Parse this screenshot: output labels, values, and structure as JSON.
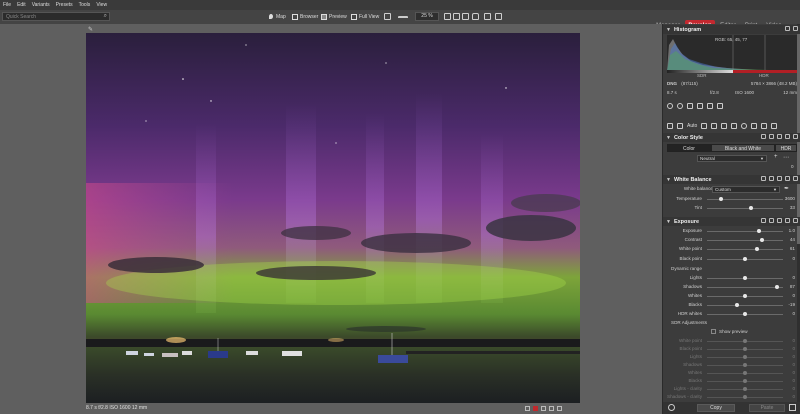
{
  "menu": [
    "File",
    "Edit",
    "Variants",
    "Presets",
    "Tools",
    "View"
  ],
  "search": {
    "placeholder": "Quick Search"
  },
  "toolbar": {
    "map": "Map",
    "browser": "Browser",
    "preview": "Preview",
    "full_view": "Full View",
    "zoom": "25 %"
  },
  "modules": [
    {
      "label": "Manager",
      "active": false
    },
    {
      "label": "Develop",
      "active": true
    },
    {
      "label": "Editor",
      "active": false
    },
    {
      "label": "Print",
      "active": false
    },
    {
      "label": "Video",
      "active": false
    }
  ],
  "status_bar": "8.7 s   f/2.8   ISO 1600   12 mm",
  "histogram": {
    "title": "Histogram",
    "rgb": "RGB: 65, 45, 77",
    "sdr_label": "SDR",
    "hdr_label": "HDR"
  },
  "file_info": {
    "format": "DNG",
    "index": "(87/115)",
    "dims": "5784 × 3866 (48.2 MB)",
    "exposure": "8.7 s",
    "aperture": "f/2.8",
    "iso": "ISO 1600",
    "focal": "12 mm"
  },
  "tools_row": {
    "auto": "Auto"
  },
  "color_style": {
    "title": "Color Style",
    "tabs": [
      "Color",
      "Black and White",
      "HDR"
    ],
    "style_label": "Style",
    "style_value": "Neutral",
    "style_amount": "0"
  },
  "white_balance": {
    "title": "White Balance",
    "wb_label": "White balance",
    "wb_value": "Custom",
    "temperature_label": "Temperature",
    "temperature_value": "3600",
    "temperature_pos": 0.18,
    "tint_label": "Tint",
    "tint_value": "33",
    "tint_pos": 0.58
  },
  "exposure": {
    "title": "Exposure",
    "rows": [
      {
        "label": "Exposure",
        "value": "1.0",
        "pos": 0.68
      },
      {
        "label": "Contrast",
        "value": "44",
        "pos": 0.72
      },
      {
        "label": "White point",
        "value": "61",
        "pos": 0.66
      },
      {
        "label": "Black point",
        "value": "0",
        "pos": 0.5
      }
    ],
    "dynamic_range": "Dynamic range",
    "dr_rows": [
      {
        "label": "Lights",
        "value": "0",
        "pos": 0.5
      },
      {
        "label": "Shadows",
        "value": "87",
        "pos": 0.92
      },
      {
        "label": "Whites",
        "value": "0",
        "pos": 0.5
      },
      {
        "label": "Blacks",
        "value": "-19",
        "pos": 0.4
      },
      {
        "label": "HDR whites",
        "value": "0",
        "pos": 0.5
      }
    ],
    "sdr_adjustments": "SDR Adjustments",
    "show_preview": "Show preview",
    "sdr_rows": [
      {
        "label": "White point",
        "value": "0"
      },
      {
        "label": "Black point",
        "value": "0"
      },
      {
        "label": "Lights",
        "value": "0"
      },
      {
        "label": "Shadows",
        "value": "0"
      },
      {
        "label": "Whites",
        "value": "0"
      },
      {
        "label": "Blacks",
        "value": "0"
      },
      {
        "label": "Lights - clarity",
        "value": "0"
      },
      {
        "label": "Shadows - clarity",
        "value": "0"
      }
    ]
  },
  "bottom": {
    "copy": "Copy",
    "paste": "Paste"
  }
}
